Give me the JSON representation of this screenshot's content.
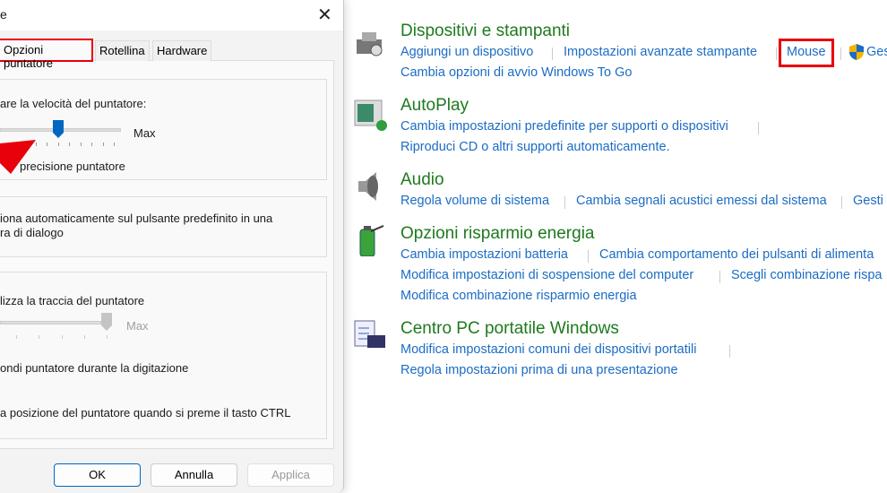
{
  "dialog": {
    "title_fragment": "e",
    "tabs": [
      "Opzioni puntatore",
      "Rotellina",
      "Hardware"
    ],
    "speed_label": "are la velocità del puntatore:",
    "speed_max": "Max",
    "speed_value_fraction": 0.5,
    "precision_label": "precisione puntatore",
    "snap_line1": "iona automaticamente sul pulsante predefinito in una",
    "snap_line2": "ra di dialogo",
    "trail_label": "lizza la traccia del puntatore",
    "trail_max": "Max",
    "hide_label": "ondi puntatore durante la digitazione",
    "ctrl_label": "a posizione del puntatore quando si preme il tasto CTRL",
    "buttons": {
      "ok": "OK",
      "cancel": "Annulla",
      "apply": "Applica"
    }
  },
  "control_panel": {
    "sections": [
      {
        "title": "Dispositivi e stampanti",
        "links": [
          "Aggiungi un dispositivo",
          "Impostazioni avanzate stampante",
          "Mouse",
          "Ges",
          "Cambia opzioni di avvio Windows To Go"
        ]
      },
      {
        "title": "AutoPlay",
        "links": [
          "Cambia impostazioni predefinite per supporti o dispositivi",
          "Riproduci CD o altri supporti automaticamente."
        ]
      },
      {
        "title": "Audio",
        "links": [
          "Regola volume di sistema",
          "Cambia segnali acustici emessi dal sistema",
          "Gesti"
        ]
      },
      {
        "title": "Opzioni risparmio energia",
        "links": [
          "Cambia impostazioni batteria",
          "Cambia comportamento dei pulsanti di alimenta",
          "Modifica impostazioni di sospensione del computer",
          "Scegli combinazione rispa",
          "Modifica combinazione risparmio energia"
        ]
      },
      {
        "title": "Centro PC portatile Windows",
        "links": [
          "Modifica impostazioni comuni dei dispositivi portatili",
          "Regola impostazioni prima di una presentazione"
        ]
      }
    ]
  },
  "colors": {
    "highlight": "#e8000b",
    "link": "#1b6cc4",
    "heading": "#1e7a1e",
    "accent": "#0067c0"
  }
}
